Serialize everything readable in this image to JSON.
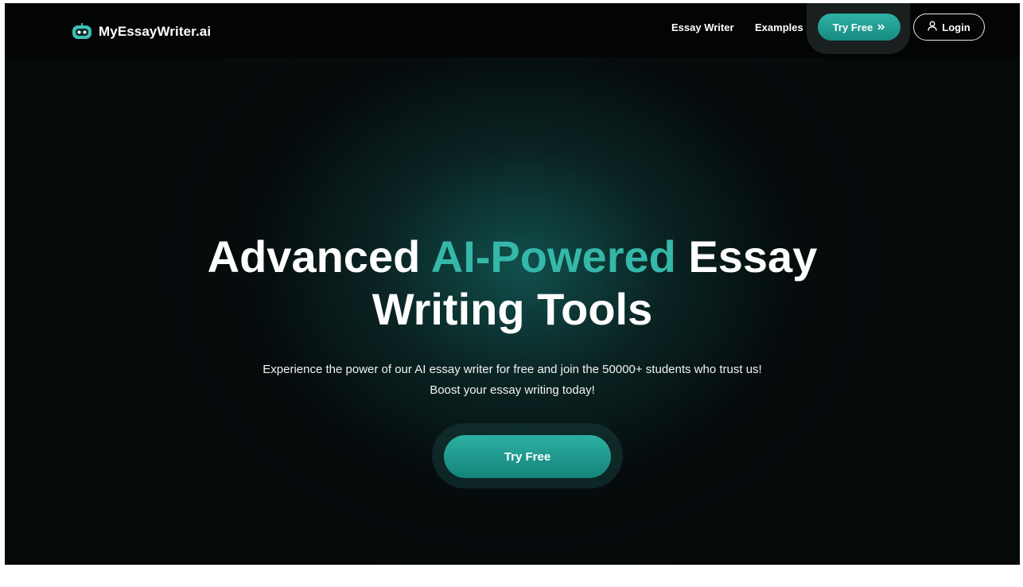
{
  "brand": {
    "name": "MyEssayWriter.ai",
    "icon": "robot-logo-icon"
  },
  "nav": {
    "links": [
      {
        "label": "Essay Writer"
      },
      {
        "label": "Examples"
      }
    ],
    "try_free_label": "Try Free",
    "try_free_icon": "double-chevron-right-icon",
    "login_label": "Login",
    "login_icon": "user-icon"
  },
  "hero": {
    "title_part1": "Advanced ",
    "title_accent": "AI-Powered",
    "title_part2": " Essay",
    "title_line2": "Writing Tools",
    "subtitle_line1": "Experience the power of our AI essay writer for free and join the 50000+ students who trust us!",
    "subtitle_line2": "Boost your essay writing today!",
    "cta_label": "Try Free"
  },
  "colors": {
    "accent": "#35b7a9",
    "button": "#1f9d91",
    "background": "#06090a"
  }
}
